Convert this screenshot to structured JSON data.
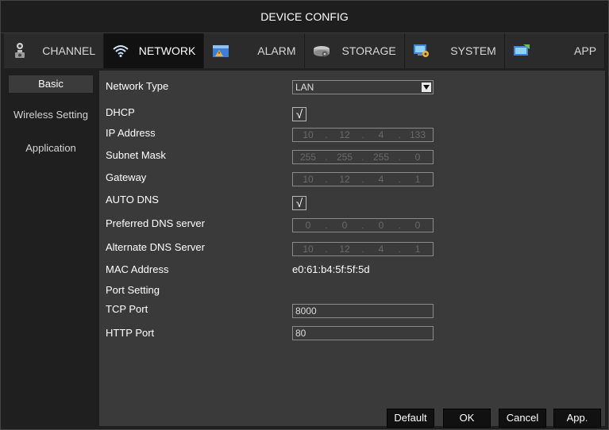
{
  "window": {
    "title": "DEVICE CONFIG"
  },
  "tabs": [
    {
      "label": "CHANNEL",
      "icon": "camera-icon"
    },
    {
      "label": "NETWORK",
      "icon": "wifi-icon",
      "active": true
    },
    {
      "label": "ALARM",
      "icon": "alarm-icon"
    },
    {
      "label": "STORAGE",
      "icon": "storage-icon"
    },
    {
      "label": "SYSTEM",
      "icon": "system-icon"
    },
    {
      "label": "APP",
      "icon": "app-icon"
    }
  ],
  "sidebar": {
    "items": [
      {
        "label": "Basic",
        "active": true
      },
      {
        "label": "Wireless Setting"
      },
      {
        "label": "Application"
      }
    ]
  },
  "form": {
    "network_type": {
      "label": "Network Type",
      "value": "LAN"
    },
    "dhcp": {
      "label": "DHCP",
      "checked": true,
      "mark": "√"
    },
    "ip_address": {
      "label": "IP Address",
      "octets": [
        "10",
        "12",
        "4",
        "133"
      ]
    },
    "subnet_mask": {
      "label": "Subnet Mask",
      "octets": [
        "255",
        "255",
        "255",
        "0"
      ]
    },
    "gateway": {
      "label": "Gateway",
      "octets": [
        "10",
        "12",
        "4",
        "1"
      ]
    },
    "auto_dns": {
      "label": "AUTO DNS",
      "checked": true,
      "mark": "√"
    },
    "preferred_dns": {
      "label": "Preferred DNS server",
      "octets": [
        "0",
        "0",
        "0",
        "0"
      ]
    },
    "alternate_dns": {
      "label": "Alternate DNS Server",
      "octets": [
        "10",
        "12",
        "4",
        "1"
      ]
    },
    "mac_address": {
      "label": "MAC Address",
      "value": "e0:61:b4:5f:5f:5d"
    },
    "port_setting": {
      "label": "Port Setting"
    },
    "tcp_port": {
      "label": "TCP Port",
      "value": "8000"
    },
    "http_port": {
      "label": "HTTP Port",
      "value": "80"
    }
  },
  "buttons": {
    "default": "Default",
    "ok": "OK",
    "cancel": "Cancel",
    "apply": "App."
  },
  "ip_separator": "."
}
